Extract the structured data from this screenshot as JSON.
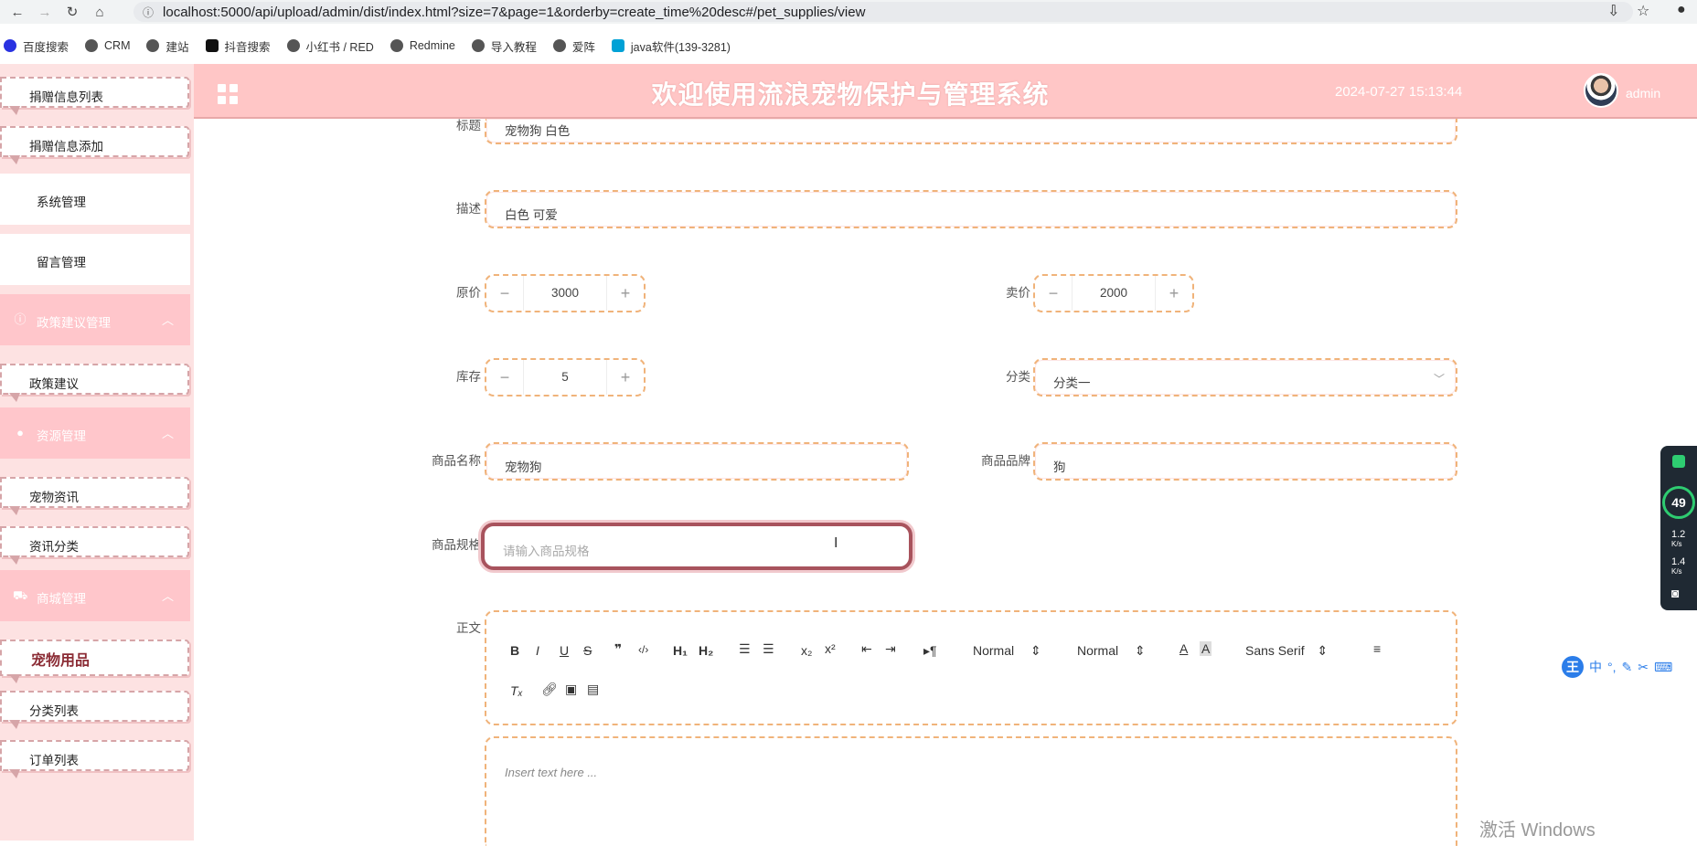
{
  "browser": {
    "url": "localhost:5000/api/upload/admin/dist/index.html?size=7&page=1&orderby=create_time%20desc#/pet_supplies/view",
    "bookmarks": [
      "百度搜索",
      "CRM",
      "建站",
      "抖音搜索",
      "小红书 / RED",
      "Redmine",
      "导入教程",
      "爱阵",
      "java软件(139-3281)"
    ]
  },
  "header": {
    "title": "欢迎使用流浪宠物保护与管理系统",
    "datetime": "2024-07-27 15:13:44",
    "user": "admin"
  },
  "sidebar": {
    "donation_list": "捐赠信息列表",
    "donation_add": "捐赠信息添加",
    "system_mgmt": "系统管理",
    "message_mgmt": "留言管理",
    "policy_group": "政策建议管理",
    "policy_item": "政策建议",
    "resource_group": "资源管理",
    "pet_news": "宠物资讯",
    "news_category": "资讯分类",
    "mall_group": "商城管理",
    "pet_supplies": "宠物用品",
    "category_list": "分类列表",
    "order_list": "订单列表"
  },
  "form": {
    "title_label": "标题",
    "title_value": "宠物狗 白色",
    "desc_label": "描述",
    "desc_value": "白色 可爱",
    "orig_price_label": "原价",
    "orig_price_value": "3000",
    "sale_price_label": "卖价",
    "sale_price_value": "2000",
    "stock_label": "库存",
    "stock_value": "5",
    "category_label": "分类",
    "category_value": "分类一",
    "name_label": "商品名称",
    "name_value": "宠物狗",
    "brand_label": "商品品牌",
    "brand_value": "狗",
    "spec_label": "商品规格",
    "spec_placeholder": "请输入商品规格",
    "body_label": "正文"
  },
  "editor": {
    "header_select": "Normal",
    "size_select": "Normal",
    "font_select": "Sans Serif",
    "placeholder": "Insert text here ..."
  },
  "system": {
    "watermark": "激活 Windows",
    "cpu_percent": "49",
    "up_speed": "1.2",
    "down_speed": "1.4",
    "speed_unit": "K/s",
    "ime": [
      "中",
      "°,"
    ]
  }
}
